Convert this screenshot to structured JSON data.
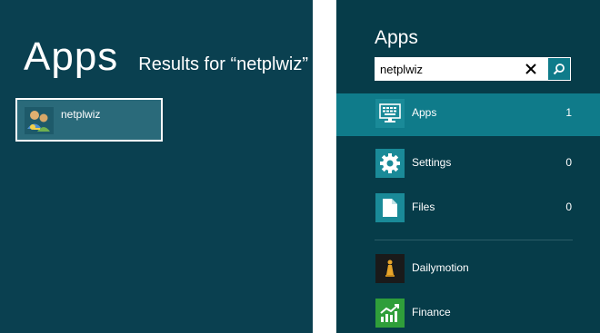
{
  "results": {
    "title": "Apps",
    "subtitle": "Results for “netplwiz”",
    "items": [
      {
        "label": "netplwiz",
        "icon": "users-icon"
      }
    ]
  },
  "charm": {
    "title": "Apps",
    "search": {
      "value": "netplwiz",
      "placeholder": ""
    },
    "scopes": [
      {
        "label": "Apps",
        "count": "1",
        "icon": "keyboard-monitor-icon",
        "selected": true
      },
      {
        "label": "Settings",
        "count": "0",
        "icon": "gear-icon",
        "selected": false
      },
      {
        "label": "Files",
        "count": "0",
        "icon": "file-icon",
        "selected": false
      }
    ],
    "apps": [
      {
        "label": "Dailymotion",
        "icon": "dailymotion-icon"
      },
      {
        "label": "Finance",
        "icon": "finance-chart-icon"
      }
    ]
  },
  "colors": {
    "background": "#0a4050",
    "charm_background": "#063c49",
    "accent": "#0f7b8a",
    "finance_green": "#2f9e3a"
  }
}
